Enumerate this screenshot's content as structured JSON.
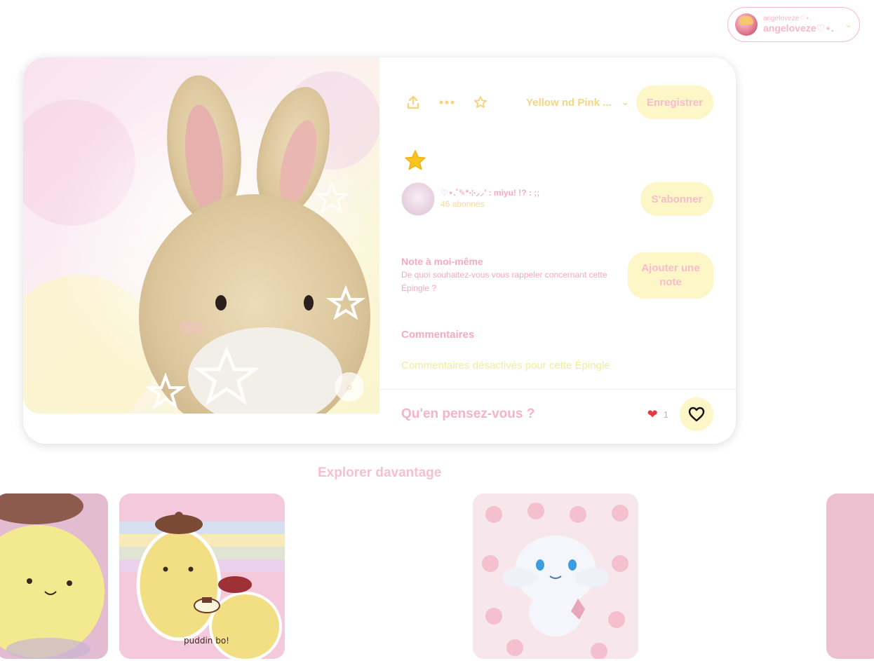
{
  "account": {
    "name_small": "angeloveze♡⋆.",
    "name_big": "angeloveze♡⋆."
  },
  "pin": {
    "toolbar": {
      "share_icon": "upload-icon",
      "more_icon": "ellipsis-icon",
      "favorite_icon": "star-outline-icon",
      "board_name": "Yellow nd Pink ...",
      "save_label": "Enregistrer"
    },
    "creator": {
      "name": "♡⋆.˚✎*⊹⸝⸝' : miyu! !? : ;;",
      "followers": "46 abonnés",
      "follow_label": "S'abonner"
    },
    "note": {
      "title": "Note à moi-même",
      "description": "De quoi souhaitez-vous vous rappeler concernant cette Épingle ?",
      "button_label": "Ajouter une note"
    },
    "comments": {
      "title": "Commentaires",
      "disabled_text": "Commentaires désactivés pour cette Épingle"
    },
    "reactions": {
      "prompt": "Qu'en pensez-vous ?",
      "count": "1"
    }
  },
  "explore": {
    "title": "Explorer davantage",
    "tile_caption": "puddin bo!"
  },
  "colors": {
    "pink": "#f6a9bf",
    "yellow_soft": "#fdf6c7",
    "yellow_text": "#f4d784",
    "heart_red": "#e63a43"
  }
}
